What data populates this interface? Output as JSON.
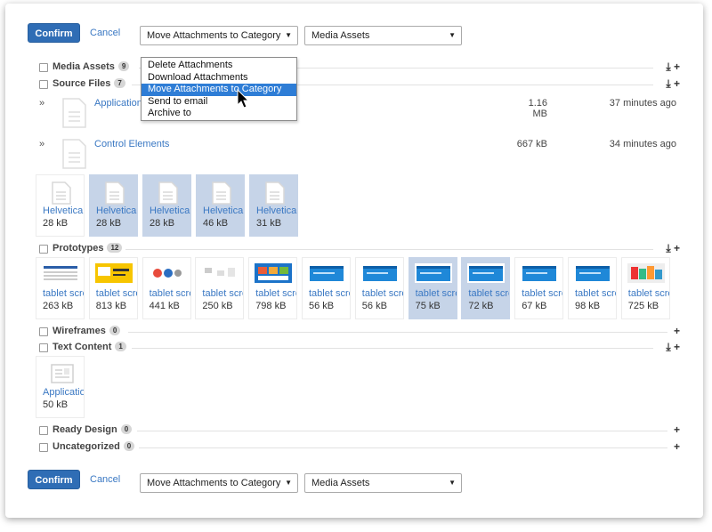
{
  "toolbar_top": {
    "confirm_label": "Confirm",
    "cancel_label": "Cancel",
    "action_value": "Move Attachments to Category",
    "category_value": "Media Assets"
  },
  "dropdown_menu": {
    "items": [
      "Delete Attachments",
      "Download Attachments",
      "Move Attachments to Category",
      "Send to email",
      "Archive to"
    ],
    "highlighted": "Move Attachments to Category"
  },
  "categories": {
    "media_assets": {
      "name": "Media Assets",
      "count": "9"
    },
    "source_files": {
      "name": "Source Files",
      "count": "7"
    },
    "prototypes": {
      "name": "Prototypes",
      "count": "12"
    },
    "wireframes": {
      "name": "Wireframes",
      "count": "0"
    },
    "text_content": {
      "name": "Text Content",
      "count": "1"
    },
    "ready_design": {
      "name": "Ready Design",
      "count": "0"
    },
    "uncategorized": {
      "name": "Uncategorized",
      "count": "0"
    }
  },
  "source_list": [
    {
      "name": "Application",
      "size": "1.16 MB",
      "time": "37 minutes ago"
    },
    {
      "name": "Control Elements",
      "size": "667 kB",
      "time": "34 minutes ago"
    }
  ],
  "source_tiles": [
    {
      "name": "Helvetica",
      "size": "28 kB",
      "selected": false
    },
    {
      "name": "Helvetica",
      "size": "28 kB",
      "selected": true
    },
    {
      "name": "Helvetica",
      "size": "28 kB",
      "selected": true
    },
    {
      "name": "Helvetica",
      "size": "46 kB",
      "selected": true
    },
    {
      "name": "Helvetica",
      "size": "31 kB",
      "selected": true
    }
  ],
  "prototype_tiles": [
    {
      "name": "tablet screen",
      "size": "263 kB",
      "selected": false,
      "thumb": "table"
    },
    {
      "name": "tablet screen",
      "size": "813 kB",
      "selected": false,
      "thumb": "yellow"
    },
    {
      "name": "tablet screen",
      "size": "441 kB",
      "selected": false,
      "thumb": "pie"
    },
    {
      "name": "tablet screen",
      "size": "250 kB",
      "selected": false,
      "thumb": "diagram"
    },
    {
      "name": "tablet screen",
      "size": "798 kB",
      "selected": false,
      "thumb": "photos"
    },
    {
      "name": "tablet screen",
      "size": "56 kB",
      "selected": false,
      "thumb": "blue"
    },
    {
      "name": "tablet screen",
      "size": "56 kB",
      "selected": false,
      "thumb": "blue"
    },
    {
      "name": "tablet screen",
      "size": "75 kB",
      "selected": true,
      "thumb": "blue"
    },
    {
      "name": "tablet screen",
      "size": "72 kB",
      "selected": true,
      "thumb": "blue"
    },
    {
      "name": "tablet screen",
      "size": "67 kB",
      "selected": false,
      "thumb": "blue"
    },
    {
      "name": "tablet screen",
      "size": "98 kB",
      "selected": false,
      "thumb": "blue"
    },
    {
      "name": "tablet screen",
      "size": "725 kB",
      "selected": false,
      "thumb": "colorful"
    }
  ],
  "text_tiles": [
    {
      "name": "Application",
      "size": "50 kB",
      "selected": false
    }
  ],
  "toolbar_bottom": {
    "confirm_label": "Confirm",
    "cancel_label": "Cancel",
    "action_value": "Move Attachments to Category",
    "category_value": "Media Assets"
  },
  "icons": {
    "download": "download-icon",
    "add": "plus-icon",
    "expand": "double-chevron-icon",
    "cursor": "mouse-pointer-icon"
  },
  "colors": {
    "primary": "#2f6db5",
    "link": "#3a78c3",
    "selected_tile": "#c6d4e8",
    "menu_highlight": "#2e7dd6"
  }
}
